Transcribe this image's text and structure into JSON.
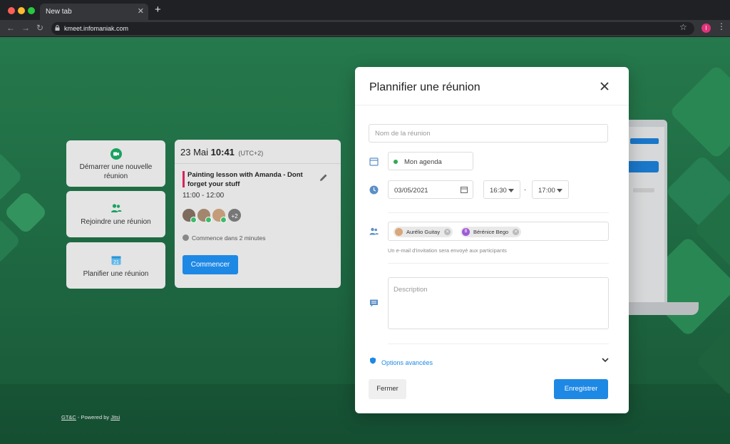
{
  "browser": {
    "tab_title": "New tab",
    "tab_close": "✕",
    "new_tab": "+",
    "url": "kmeet.infomaniak.com",
    "profile_initial": "I"
  },
  "actions": [
    {
      "label": "Démarrer une nouvelle réunion",
      "icon": "video-camera-icon"
    },
    {
      "label": "Rejoindre une réunion",
      "icon": "people-icon"
    },
    {
      "label": "Planifier une réunion",
      "icon": "calendar-icon"
    }
  ],
  "next_meeting": {
    "day": "23 Mai",
    "time": "10:41",
    "timezone": "(UTC+2)",
    "title": "Painting lesson with Amanda - Dont forget your stuff",
    "slot": "11:00 - 12:00",
    "extra_participants": "+2",
    "starts_in": "Commence dans 2 minutes",
    "start_button": "Commencer"
  },
  "footer": {
    "gtc": "GT&C",
    "powered": " - Powered by ",
    "jitsi": "Jitsi"
  },
  "dialog": {
    "title": "Plannifier une réunion",
    "name_placeholder": "Nom de la réunion",
    "agenda": "Mon agenda",
    "date": "03/05/2021",
    "start_time": "16:30",
    "time_separator": "-",
    "end_time": "17:00",
    "participants": [
      {
        "name": "Aurélio Guitay",
        "avatar_color": "#d9a77a"
      },
      {
        "name": "Bérénice Bego",
        "avatar_color": "#a05ad6",
        "initial": "B"
      }
    ],
    "invite_hint": "Un e-mail d'invitation sera envoyé aux participants",
    "description_placeholder": "Description",
    "advanced_options": "Options avancées",
    "close_button": "Fermer",
    "save_button": "Enregistrer"
  },
  "colors": {
    "brand_green": "#2b8a57",
    "primary_blue": "#1e88e5",
    "agenda_dot": "#34a853"
  }
}
